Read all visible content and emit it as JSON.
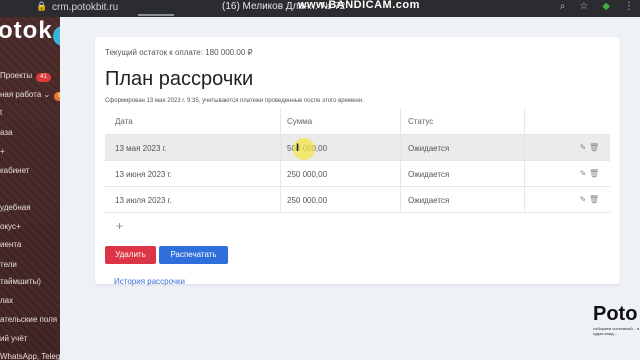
{
  "browser": {
    "url": "crm.potokbit.ru",
    "tab_title": "(16) Меликов Длан...",
    "tab_suffix": "№ 72",
    "watermark": "www.BANDICAM.com"
  },
  "sidebar": {
    "logo": "otok",
    "items": [
      {
        "label": "Проекты",
        "badge": "41"
      },
      {
        "label": "ная работа",
        "badge": "8"
      },
      {
        "label": "t"
      },
      {
        "label": "аза"
      },
      {
        "label": "+"
      },
      {
        "label": "кабинет"
      },
      {
        "label": "удебная"
      },
      {
        "label": "окус+"
      },
      {
        "label": "иента"
      },
      {
        "label": "тели"
      },
      {
        "label": "таймшиты)"
      },
      {
        "label": "лах"
      },
      {
        "label": "ательские поля"
      },
      {
        "label": "ий учёт"
      },
      {
        "label": "WhatsApp, Teleg..."
      }
    ]
  },
  "card": {
    "balance": "Текущий остаток к оплате: 180 000.00 ₽",
    "title": "План рассрочки",
    "generated_note": "Сформирован 13 мая 2023 г. 9:35, учитываются платежи проведенные после этого времени.",
    "columns": [
      "Дата",
      "Сумма",
      "Статус"
    ],
    "rows": [
      {
        "date": "13 мая 2023 г.",
        "amount": "500 000,00",
        "status": "Ожидается"
      },
      {
        "date": "13 июня 2023 г.",
        "amount": "250 000,00",
        "status": "Ожидается"
      },
      {
        "date": "13 июля 2023 г.",
        "amount": "250 000,00",
        "status": "Ожидается"
      }
    ],
    "add_symbol": "+",
    "delete_label": "Удалить",
    "print_label": "Распечатать",
    "history_link": "История рассрочки"
  },
  "brand": {
    "name": "Poto",
    "tagline": "собираем системный... в судах кажд..."
  },
  "colors": {
    "delete": "#dc3545",
    "print": "#2f6fdb",
    "link": "#3a6fd8",
    "collapse_button": "#36b5d8"
  }
}
